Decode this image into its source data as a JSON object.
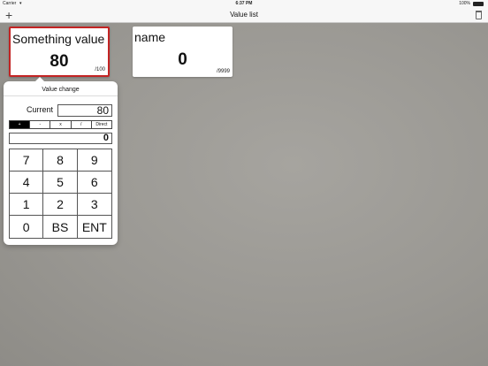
{
  "status_bar": {
    "carrier": "Carrier",
    "time": "6:37 PM",
    "battery": "100%"
  },
  "nav": {
    "title": "Value list",
    "add_icon": "plus-icon",
    "trash_icon": "trash-icon"
  },
  "cards": [
    {
      "name": "Something value",
      "value": "80",
      "max": "/100",
      "selected": true
    },
    {
      "name": "name",
      "value": "0",
      "max": "/9999",
      "selected": false
    }
  ],
  "popover": {
    "title": "Value change",
    "current_label": "Current",
    "current_value": "80",
    "operations": [
      "+",
      "-",
      "x",
      "/",
      "Direct"
    ],
    "active_operation": "+",
    "entry_value": "0",
    "keys": [
      "7",
      "8",
      "9",
      "4",
      "5",
      "6",
      "1",
      "2",
      "3",
      "0",
      "BS",
      "ENT"
    ]
  },
  "colors": {
    "selected_border": "#c32424",
    "background": "#9a9893"
  }
}
